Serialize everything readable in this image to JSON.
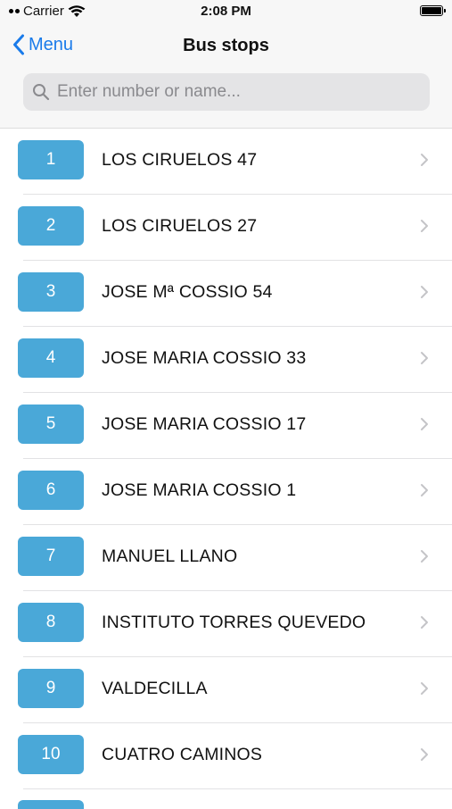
{
  "status_bar": {
    "carrier": "Carrier",
    "time": "2:08 PM",
    "battery_level": 1.0
  },
  "nav": {
    "back_label": "Menu",
    "title": "Bus stops"
  },
  "search": {
    "placeholder": "Enter number or name...",
    "value": ""
  },
  "stops": [
    {
      "number": "1",
      "name": "LOS CIRUELOS 47"
    },
    {
      "number": "2",
      "name": "LOS CIRUELOS 27"
    },
    {
      "number": "3",
      "name": "JOSE Mª COSSIO 54"
    },
    {
      "number": "4",
      "name": "JOSE MARIA COSSIO 33"
    },
    {
      "number": "5",
      "name": "JOSE MARIA COSSIO 17"
    },
    {
      "number": "6",
      "name": "JOSE MARIA COSSIO 1"
    },
    {
      "number": "7",
      "name": "MANUEL LLANO"
    },
    {
      "number": "8",
      "name": "INSTITUTO TORRES QUEVEDO"
    },
    {
      "number": "9",
      "name": "VALDECILLA"
    },
    {
      "number": "10",
      "name": "CUATRO CAMINOS"
    }
  ],
  "colors": {
    "accent": "#1a7bea",
    "badge": "#4aa8d8",
    "chevron": "#c4c4c7"
  },
  "icons": {
    "back": "chevron-left-icon",
    "search": "search-icon",
    "row": "chevron-right-icon",
    "wifi": "wifi-icon",
    "battery": "battery-icon"
  }
}
